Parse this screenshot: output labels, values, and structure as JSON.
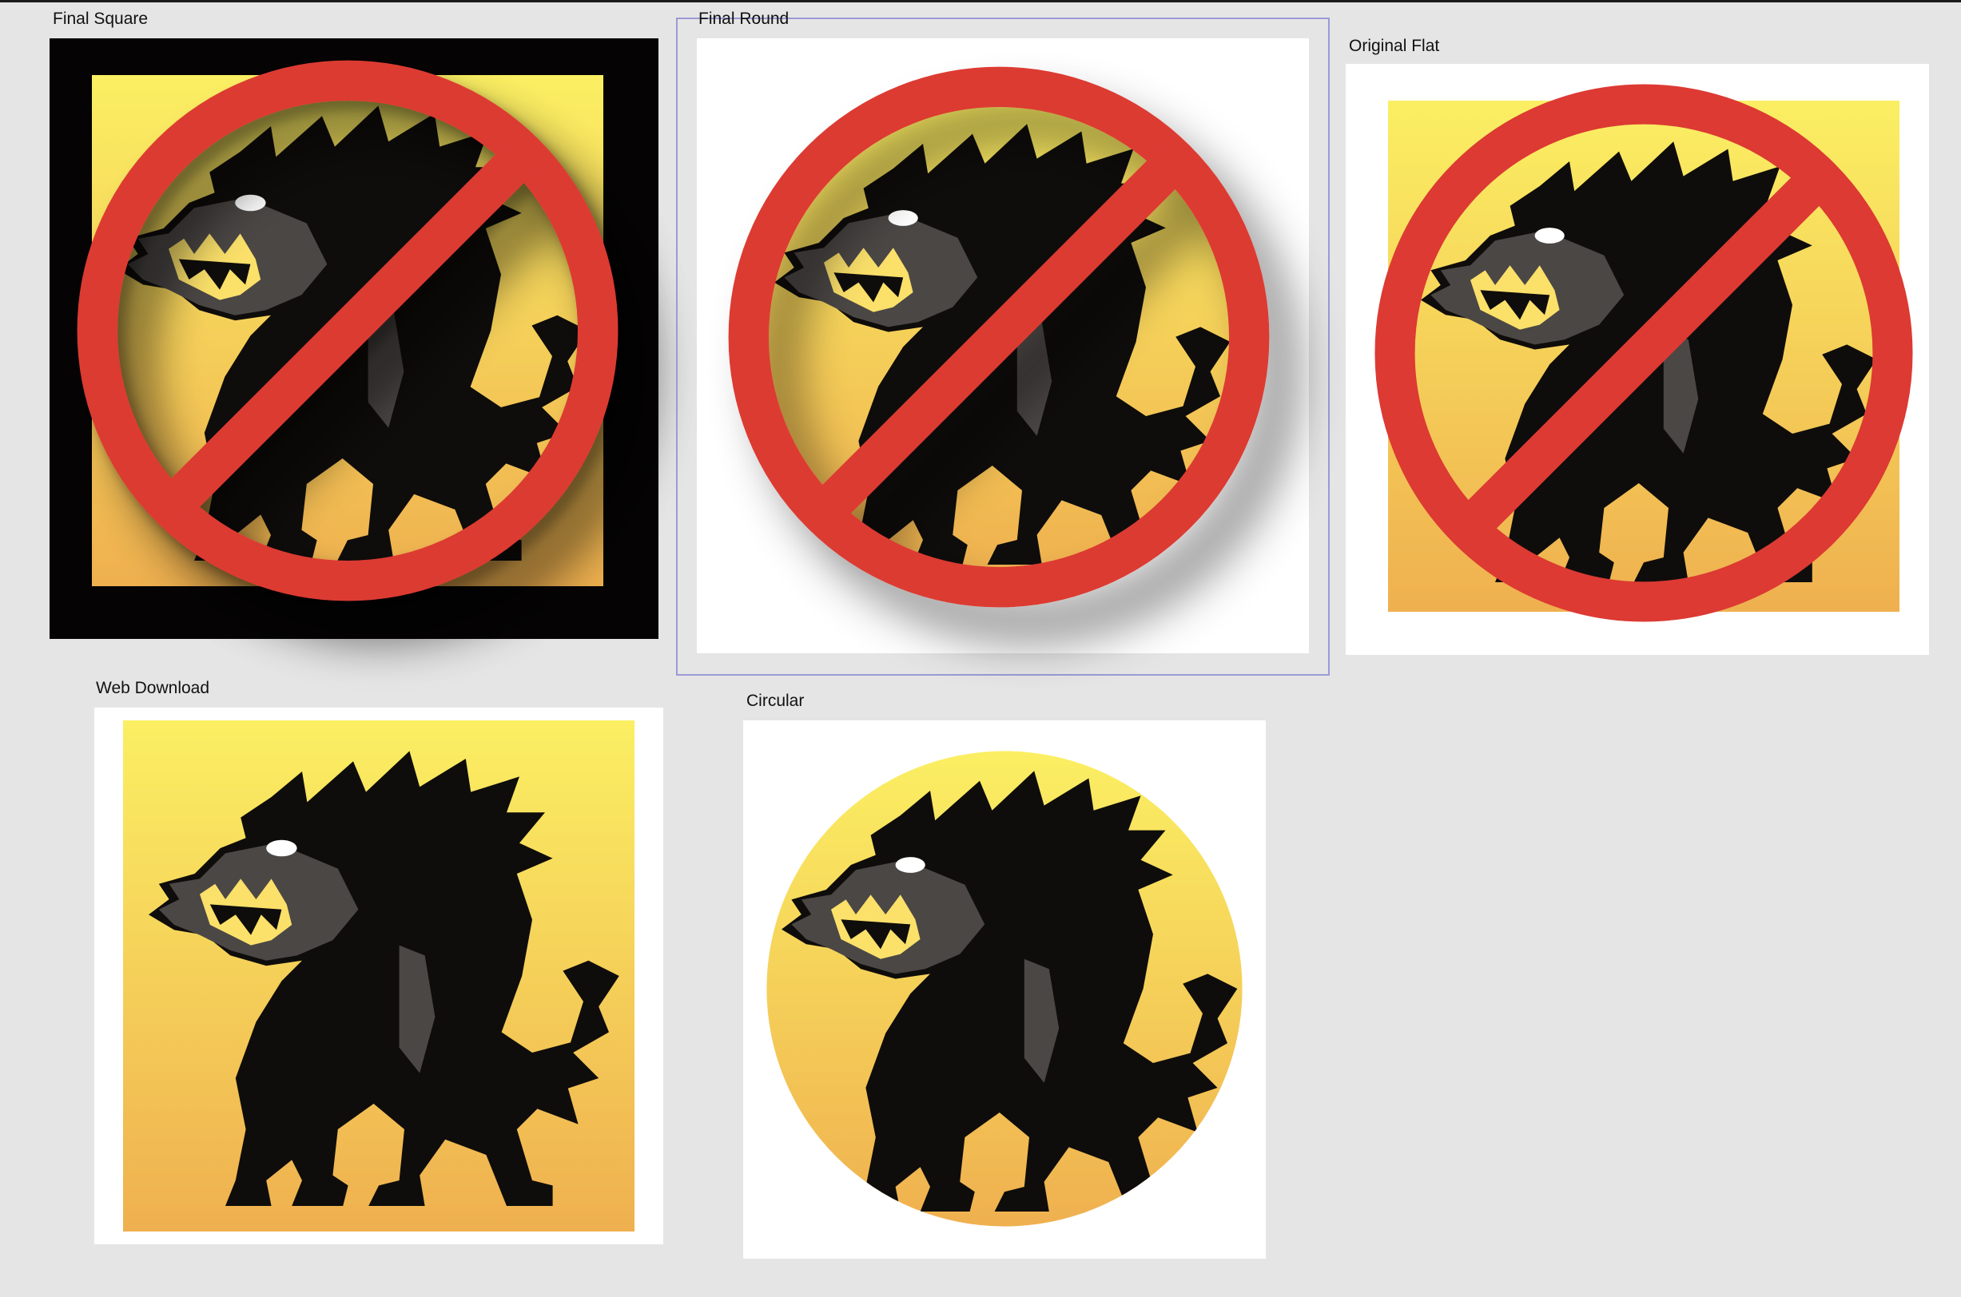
{
  "canvas": {
    "artboards": [
      {
        "label": "Final Square",
        "style": "square-dark",
        "no_sign": true,
        "shadow": true,
        "selected": false
      },
      {
        "label": "Final Round",
        "style": "round",
        "no_sign": true,
        "shadow": true,
        "selected": true
      },
      {
        "label": "Original Flat",
        "style": "square-flat",
        "no_sign": true,
        "shadow": false,
        "selected": false
      },
      {
        "label": "Web Download",
        "style": "square-plain",
        "no_sign": false,
        "shadow": false,
        "selected": false
      },
      {
        "label": "Circular",
        "style": "circle",
        "no_sign": false,
        "shadow": false,
        "selected": false
      }
    ]
  },
  "colors": {
    "canvas_bg": "#e5e5e5",
    "gradient_top": "#fbef63",
    "gradient_bottom": "#efb04f",
    "no_sign_red": "#dc3a33",
    "wolf_black": "#0f0d0b",
    "wolf_gray": "#4b4745",
    "selection": "#9a9ad6"
  },
  "icons": {
    "wolf": "werewolf-silhouette-icon",
    "no_sign": "prohibition-sign-icon"
  }
}
